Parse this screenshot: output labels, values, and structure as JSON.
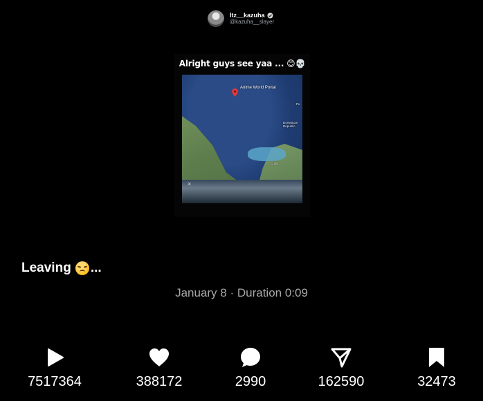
{
  "post": {
    "author_display_name": "Itz__kazuha",
    "author_handle": "@kazuha__slayer",
    "media_caption": "Alright guys see yaa ... 😊💀",
    "map_labels": {
      "pin": "Anime World Portal",
      "dominican": "Dominican Republic",
      "cuba": "Cuba",
      "puerto": "Pu"
    },
    "close_glyph": "×",
    "body_text": "Leaving",
    "body_trailer": "...",
    "meta": "January 8 · Duration 0:09"
  },
  "stats": {
    "plays": "7517364",
    "likes": "388172",
    "comments": "2990",
    "shares": "162590",
    "bookmarks": "32473"
  },
  "icons": [
    "verified-badge-icon",
    "map-pin-icon",
    "close-icon",
    "play-icon",
    "heart-icon",
    "comment-icon",
    "share-icon",
    "bookmark-icon"
  ]
}
